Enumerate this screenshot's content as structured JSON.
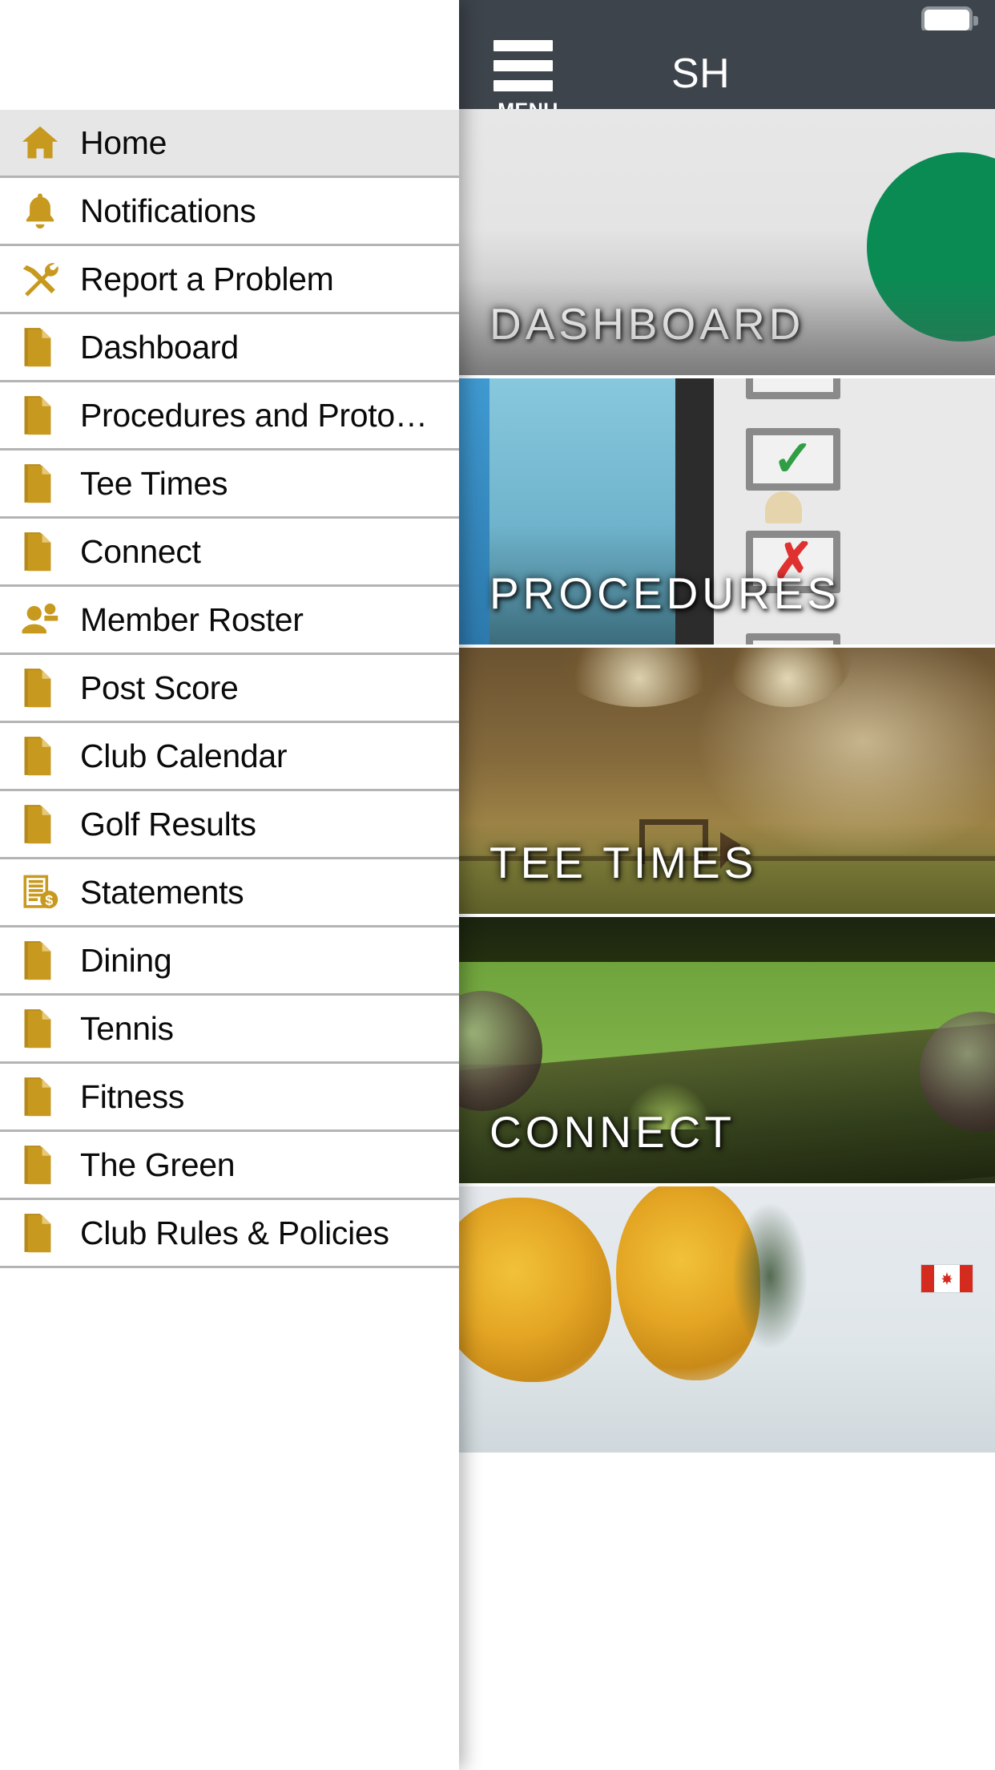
{
  "status_bar": {
    "battery_icon": "battery-full-icon"
  },
  "header": {
    "menu_icon": "hamburger-menu-icon",
    "menu_label": "MENU",
    "title": "SH"
  },
  "drawer": {
    "items": [
      {
        "label": "Home",
        "icon": "home-icon",
        "selected": true
      },
      {
        "label": "Notifications",
        "icon": "bell-icon",
        "selected": false
      },
      {
        "label": "Report a Problem",
        "icon": "hammer-wrench-icon",
        "selected": false
      },
      {
        "label": "Dashboard",
        "icon": "document-icon",
        "selected": false
      },
      {
        "label": "Procedures and Proto…",
        "icon": "document-icon",
        "selected": false
      },
      {
        "label": "Tee Times",
        "icon": "document-icon",
        "selected": false
      },
      {
        "label": "Connect",
        "icon": "document-icon",
        "selected": false
      },
      {
        "label": "Member Roster",
        "icon": "people-icon",
        "selected": false
      },
      {
        "label": "Post Score",
        "icon": "document-icon",
        "selected": false
      },
      {
        "label": "Club Calendar",
        "icon": "document-icon",
        "selected": false
      },
      {
        "label": "Golf Results",
        "icon": "document-icon",
        "selected": false
      },
      {
        "label": "Statements",
        "icon": "invoice-dollar-icon",
        "selected": false
      },
      {
        "label": "Dining",
        "icon": "document-icon",
        "selected": false
      },
      {
        "label": "Tennis",
        "icon": "document-icon",
        "selected": false
      },
      {
        "label": "Fitness",
        "icon": "document-icon",
        "selected": false
      },
      {
        "label": "The Green",
        "icon": "document-icon",
        "selected": false
      },
      {
        "label": "Club Rules & Policies",
        "icon": "document-icon",
        "selected": false
      }
    ]
  },
  "tiles": [
    {
      "label": "DASHBOARD",
      "style": "bg-dashboard"
    },
    {
      "label": "PROCEDURES",
      "style": "bg-procedures"
    },
    {
      "label": "TEE TIMES",
      "style": "bg-teetimes"
    },
    {
      "label": "CONNECT",
      "style": "bg-connect"
    },
    {
      "label": "",
      "style": "bg-autumn"
    }
  ],
  "colors": {
    "accent_gold": "#c8991f",
    "header_dark": "#3d444b",
    "selected_row": "#e6e6e6",
    "divider": "#b4b4b4",
    "logo_green": "#0b8b54"
  }
}
